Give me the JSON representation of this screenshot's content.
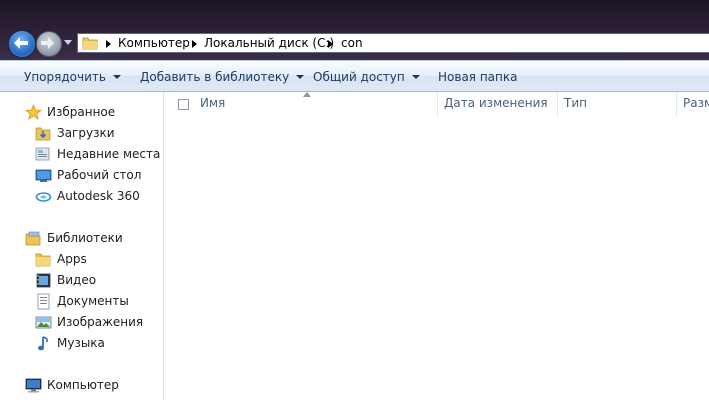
{
  "address_bar": {
    "crumbs": [
      "Компьютер",
      "Локальный диск (C:)",
      "con"
    ]
  },
  "toolbar": {
    "organize": "Упорядочить",
    "add_to_library": "Добавить в библиотеку",
    "share": "Общий доступ",
    "new_folder": "Новая папка"
  },
  "nav": {
    "favorites": {
      "label": "Избранное",
      "items": [
        "Загрузки",
        "Недавние места",
        "Рабочий стол",
        "Autodesk 360"
      ]
    },
    "libraries": {
      "label": "Библиотеки",
      "items": [
        "Apps",
        "Видео",
        "Документы",
        "Изображения",
        "Музыка"
      ]
    },
    "computer": {
      "label": "Компьютер"
    }
  },
  "columns": {
    "name": "Имя",
    "date_modified": "Дата изменения",
    "type": "Тип",
    "size": "Разм"
  },
  "colors": {
    "titlebar": "#2a1f35",
    "toolbar_text": "#1e395b",
    "header_text": "#4c607a",
    "accent_blue": "#2d6fc9"
  }
}
